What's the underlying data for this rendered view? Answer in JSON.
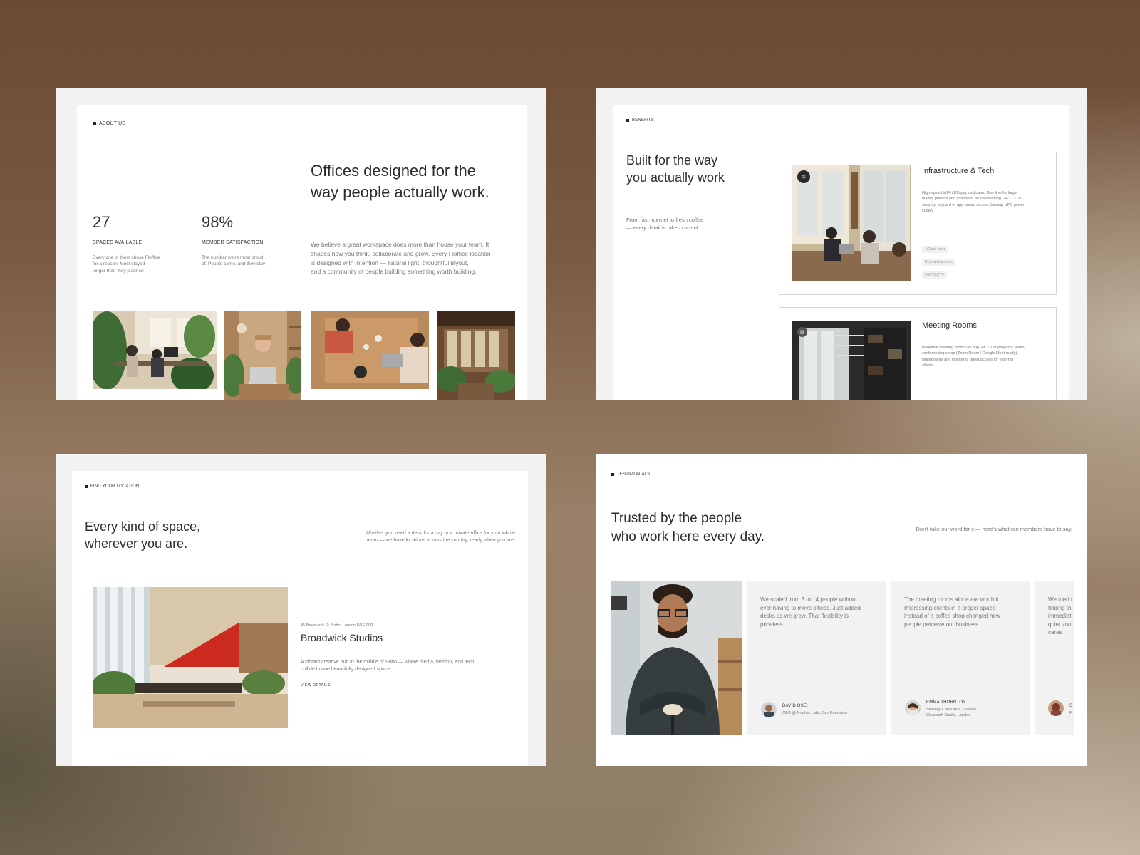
{
  "about": {
    "eyebrow": "ABOUT US",
    "heading_line1": "Offices designed for the",
    "heading_line2": "way people actually work.",
    "stats": [
      {
        "value": "27",
        "label": "SPACES AVAILABLE",
        "desc_line1": "Every one of them chose Flofflce",
        "desc_line2": "for a reason. Most stayed",
        "desc_line3": "longer than they planned"
      },
      {
        "value": "98%",
        "label": "MEMBER SATISFACTION",
        "desc_line1": "The number we're most proud",
        "desc_line2": "of. People come, and they stay",
        "desc_line3": ""
      }
    ],
    "body_line1": "We believe a great workspace does more than house your team. It",
    "body_line2": "shapes how you think, collaborate and grow. Every Floffice location",
    "body_line3": "is designed with intention — natural light, thoughtful layout,",
    "body_line4": "and a community of people building something worth building."
  },
  "benefits": {
    "eyebrow": "BENEFITS",
    "heading_line1": "Built for the way",
    "heading_line2": "you actually work",
    "sub_line1": "From fast internet to fresh coffee",
    "sub_line2": "— every detail is taken care of.",
    "items": [
      {
        "title": "Infrastructure & Tech",
        "desc_line1": "High-speed WiFi (1Gbps), dedicated fiber line for larger",
        "desc_line2": "teams, printers and scanners, air conditioning, 24/7 CCTV",
        "desc_line3": "security, keycard or app-based access, backup UPS power",
        "desc_line4": "supply",
        "tags": [
          "1Gbps fiber",
          "Keycard access",
          "24/7 CCTV"
        ]
      },
      {
        "title": "Meeting Rooms",
        "desc_line1": "Bookable meeting rooms via app, 4K TV or projector, video",
        "desc_line2": "conferencing setup (Zoom Room / Google Meet ready),",
        "desc_line3": "whiteboards and flipcharts, guest access for external",
        "desc_line4": "clients."
      }
    ]
  },
  "location": {
    "eyebrow": "FIND YOUR LOCATION",
    "heading_line1": "Every kind of space,",
    "heading_line2": "wherever you are.",
    "intro_line1": "Whether you need a desk for a day or a private office for your whole",
    "intro_line2": "team — we have locations across the country, ready when you are.",
    "address": "45 Broadwick St, Soho, London W1F 9QT",
    "name": "Broadwick Studios",
    "desc_line1": "A vibrant creative hub in the middle of Soho — where media, fashion, and tech",
    "desc_line2": "collide in one beautifully designed space.",
    "cta": "VIEW DETAILS"
  },
  "testimonials": {
    "eyebrow": "TESTIMONIALS",
    "heading_line1": "Trusted by the people",
    "heading_line2": "who work here every day.",
    "intro": "Don't take our word for it — here's what our members have to say.",
    "items": [
      {
        "q1": "We scaled from 3 to 14 people without",
        "q2": "ever having to move offices. Just added",
        "q3": "desks as we grew. That flexibility is",
        "q4": "priceless.",
        "name": "DAVID OSEI",
        "role": "CEO @ Nordvik Labs, San Francisco",
        "role2": ""
      },
      {
        "q1": "The meeting rooms alone are worth it.",
        "q2": "Impressing clients in a proper space",
        "q3": "instead of a coffee shop changed how",
        "q4": "people perceive our business.",
        "name": "EMMA THORNTON",
        "role": "Strategy Consultant, London",
        "role2": "Clearpath Studio, London"
      },
      {
        "q1": "We tried t",
        "q2": "finding thi",
        "q3": "immediat",
        "q4": "quiet zon",
        "q5": "cares",
        "name": "S",
        "role": "F"
      }
    ]
  }
}
